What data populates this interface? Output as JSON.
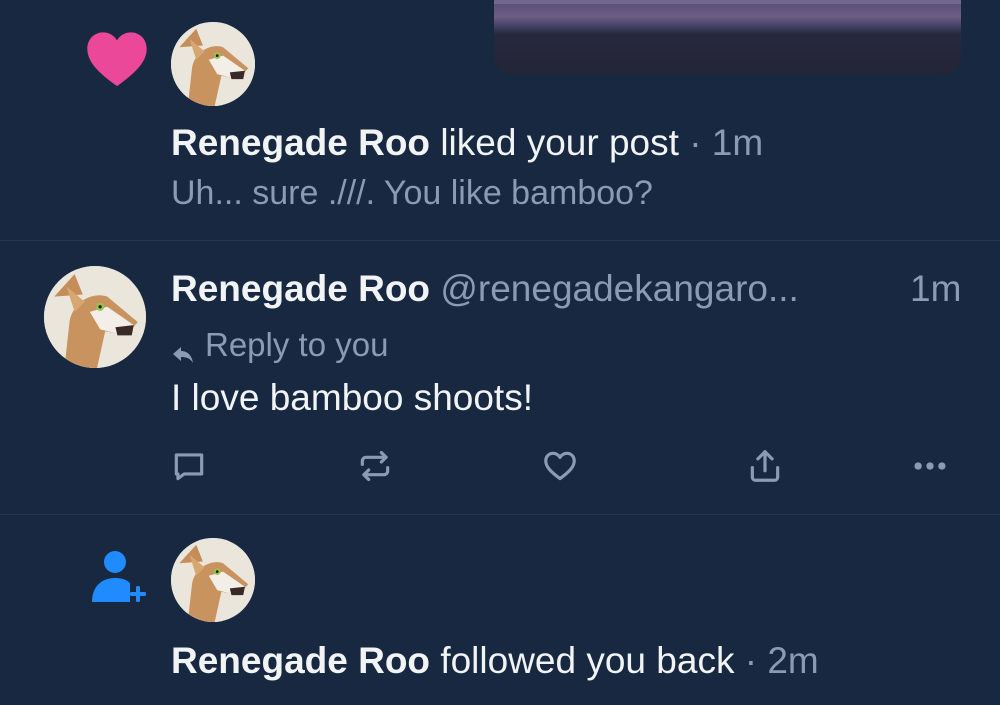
{
  "colors": {
    "background": "#172840",
    "heart": "#ec4899",
    "follow_accent": "#208bfe",
    "muted_text": "#8a9bb2",
    "divider": "#22374f"
  },
  "notifications": [
    {
      "type": "like",
      "icon": "heart-icon",
      "author": "Renegade Roo",
      "action": "liked your post",
      "separator": "·",
      "time": "1m",
      "preview": "Uh... sure .///. You like bamboo?"
    },
    {
      "type": "reply",
      "author": "Renegade Roo",
      "handle": "@renegadekangaro...",
      "time": "1m",
      "reply_label": "Reply to you",
      "body": "I love bamboo shoots!",
      "actions": [
        "comment-icon",
        "repost-icon",
        "like-icon",
        "share-icon",
        "more-icon"
      ]
    },
    {
      "type": "follow",
      "icon": "person-add-icon",
      "author": "Renegade Roo",
      "action": "followed you back",
      "separator": "·",
      "time": "2m"
    }
  ]
}
